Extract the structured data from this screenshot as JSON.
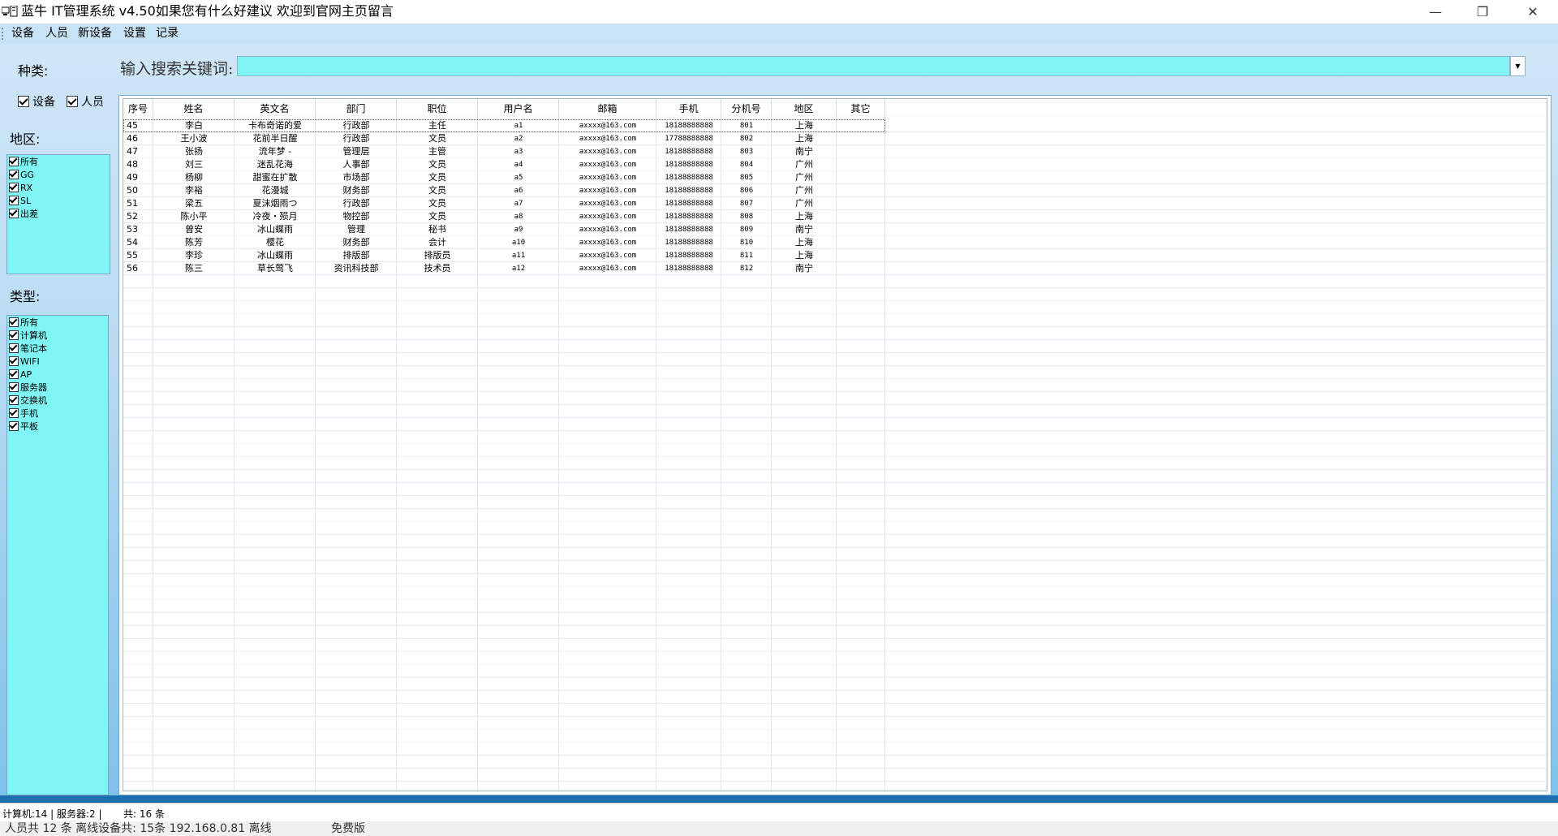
{
  "window": {
    "title": "蓝牛 IT管理系统  v4.50如果您有什么好建议 欢迎到官网主页留言",
    "controls": {
      "minimize": "—",
      "maximize": "❐",
      "close": "✕"
    }
  },
  "menu": [
    "设备",
    "人员",
    "新设备",
    "设置",
    "记录"
  ],
  "sidebar": {
    "kind_label": "种类:",
    "kind_checks": [
      "设备",
      "人员"
    ],
    "region_label": "地区:",
    "regions": [
      "所有",
      "GG",
      "RX",
      "SL",
      "出差"
    ],
    "type_label": "类型:",
    "types": [
      "所有",
      "计算机",
      "笔记本",
      "WIFI",
      "AP",
      "服务器",
      "交换机",
      "手机",
      "平板"
    ]
  },
  "search": {
    "label": "输入搜索关键词:",
    "value": ""
  },
  "table": {
    "columns": [
      "序号",
      "姓名",
      "英文名",
      "部门",
      "职位",
      "用户名",
      "邮箱",
      "手机",
      "分机号",
      "地区",
      "其它"
    ],
    "rows": [
      [
        "45",
        "李白",
        "卡布奇诺的爱",
        "行政部",
        "主任",
        "a1",
        "axxxx@163.com",
        "18188888888",
        "801",
        "上海",
        ""
      ],
      [
        "46",
        "王小波",
        "花前半日醒",
        "行政部",
        "文员",
        "a2",
        "axxxx@163.com",
        "17788888888",
        "802",
        "上海",
        ""
      ],
      [
        "47",
        "张扬",
        "流年梦 -",
        "管理层",
        "主管",
        "a3",
        "axxxx@163.com",
        "18188888888",
        "803",
        "南宁",
        ""
      ],
      [
        "48",
        "刘三",
        "迷乱花海",
        "人事部",
        "文员",
        "a4",
        "axxxx@163.com",
        "18188888888",
        "804",
        "广州",
        ""
      ],
      [
        "49",
        "杨柳",
        "甜蜜在扩散",
        "市场部",
        "文员",
        "a5",
        "axxxx@163.com",
        "18188888888",
        "805",
        "广州",
        ""
      ],
      [
        "50",
        "李裕",
        "花漫城",
        "财务部",
        "文员",
        "a6",
        "axxxx@163.com",
        "18188888888",
        "806",
        "广州",
        ""
      ],
      [
        "51",
        "梁五",
        "夏沫烟雨つ",
        "行政部",
        "文员",
        "a7",
        "axxxx@163.com",
        "18188888888",
        "807",
        "广州",
        ""
      ],
      [
        "52",
        "陈小平",
        "冷夜・殒月",
        "物控部",
        "文员",
        "a8",
        "axxxx@163.com",
        "18188888888",
        "808",
        "上海",
        ""
      ],
      [
        "53",
        "曾安",
        "冰山蝶雨",
        "管理",
        "秘书",
        "a9",
        "axxxx@163.com",
        "18188888888",
        "809",
        "南宁",
        ""
      ],
      [
        "54",
        "陈芳",
        "樱花",
        "财务部",
        "会计",
        "a10",
        "axxxx@163.com",
        "18188888888",
        "810",
        "上海",
        ""
      ],
      [
        "55",
        "李珍",
        "冰山蝶雨",
        "排版部",
        "排版员",
        "a11",
        "axxxx@163.com",
        "18188888888",
        "811",
        "上海",
        ""
      ],
      [
        "56",
        "陈三",
        "草长莺飞",
        "资讯科技部",
        "技术员",
        "a12",
        "axxxx@163.com",
        "18188888888",
        "812",
        "南宁",
        ""
      ]
    ]
  },
  "status": {
    "line1": [
      "计算机:14 | 服务器:2 |",
      "共: 16 条"
    ],
    "line2": [
      "人员共 12 条   离线设备共: 15条   192.168.0.81 离线",
      "免费版"
    ]
  }
}
